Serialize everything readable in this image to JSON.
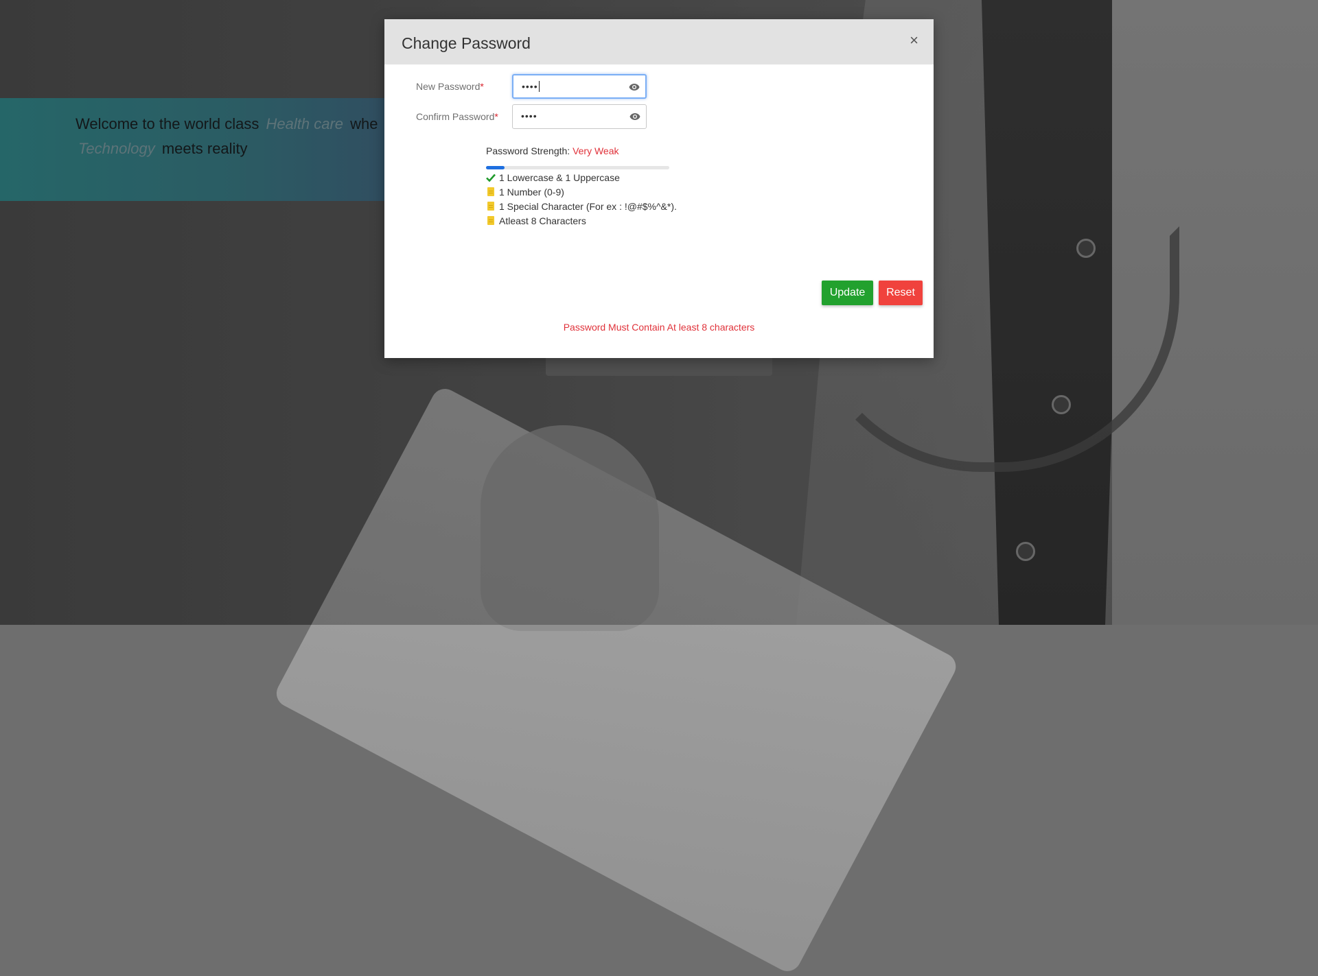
{
  "background": {
    "banner": {
      "text_1": "Welcome to the world class",
      "highlight_1": "Health care",
      "text_2": "whe",
      "highlight_2": "Technology",
      "text_3": "meets reality"
    }
  },
  "modal": {
    "title": "Change Password",
    "close_label": "×",
    "new_password": {
      "label": "New Password",
      "required_mark": "*",
      "masked_value": "••••",
      "toggle_icon": "eye-icon"
    },
    "confirm_password": {
      "label": "Confirm Password",
      "required_mark": "*",
      "masked_value": "••••",
      "toggle_icon": "eye-icon"
    },
    "strength": {
      "label": "Password Strength:",
      "value": "Very Weak",
      "fill_percent": 10,
      "fill_color": "#1e6fe0"
    },
    "rules": [
      {
        "text": "1 Lowercase & 1 Uppercase",
        "met": true,
        "icon": "check-icon"
      },
      {
        "text": "1 Number (0-9)",
        "met": false,
        "icon": "document-icon"
      },
      {
        "text": "1 Special Character (For ex : !@#$%^&*).",
        "met": false,
        "icon": "document-icon"
      },
      {
        "text": "Atleast 8 Characters",
        "met": false,
        "icon": "document-icon"
      }
    ],
    "buttons": {
      "update_label": "Update",
      "reset_label": "Reset"
    },
    "error_message": "Password Must Contain At least 8 characters"
  },
  "colors": {
    "update_button": "#22a12e",
    "reset_button": "#f0423d",
    "error_text": "#e0323a",
    "header_bg": "#e2e2e2"
  }
}
